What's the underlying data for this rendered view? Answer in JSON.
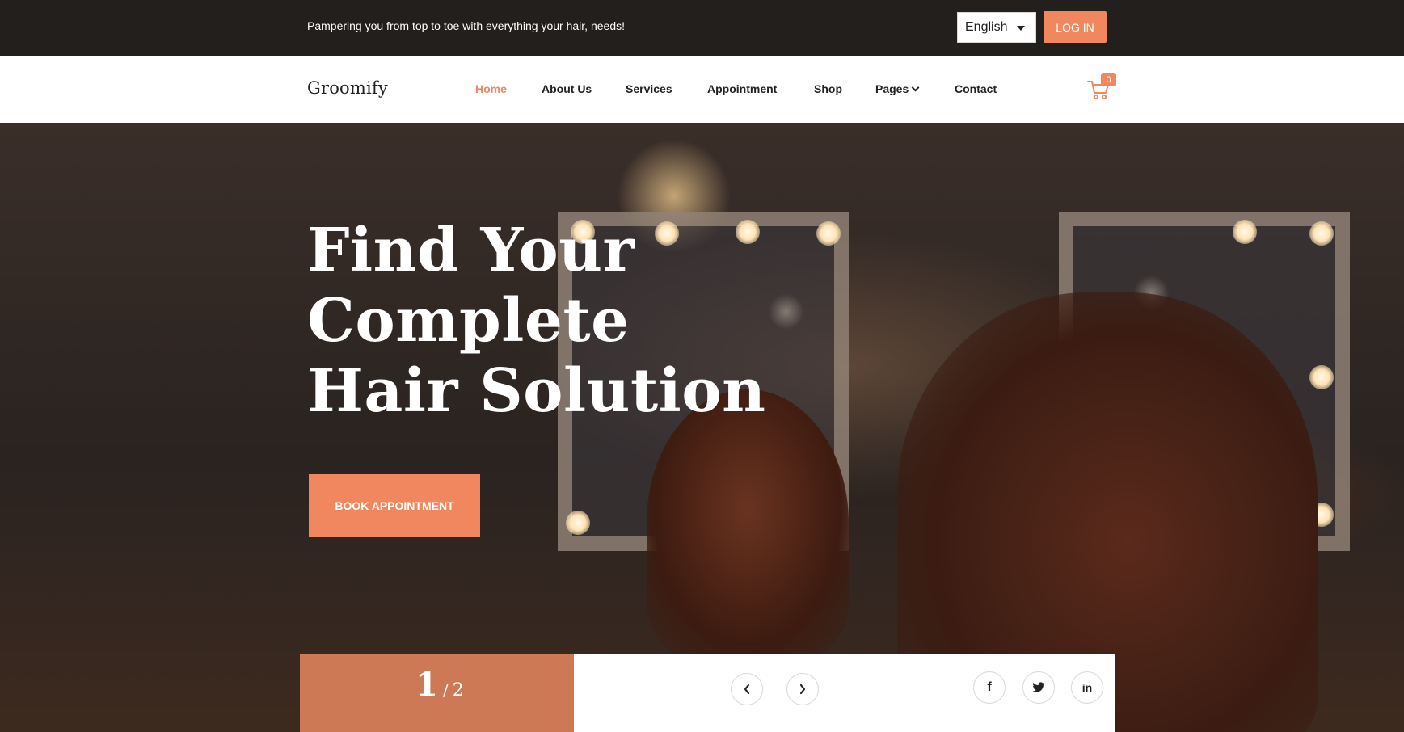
{
  "topbar": {
    "tagline": "Pampering you from top to toe with everything your hair, needs!",
    "language": "English",
    "login_label": "LOG IN"
  },
  "nav": {
    "logo": "Groomify",
    "items": [
      {
        "label": "Home",
        "active": true
      },
      {
        "label": "About Us"
      },
      {
        "label": "Services"
      },
      {
        "label": "Appointment"
      },
      {
        "label": "Shop"
      },
      {
        "label": "Pages",
        "has_dropdown": true
      },
      {
        "label": "Contact"
      }
    ],
    "cart_count": "0"
  },
  "hero": {
    "title_lines": [
      "Find Your",
      "Complete",
      "Hair Solution"
    ],
    "cta_label": "BOOK APPOINTMENT"
  },
  "slider": {
    "current": "1",
    "separator": "/",
    "total": "2",
    "prev_icon": "chevron-left-icon",
    "next_icon": "chevron-right-icon"
  },
  "social": [
    {
      "icon": "facebook-icon",
      "glyph": "f"
    },
    {
      "icon": "twitter-icon"
    },
    {
      "icon": "linkedin-icon",
      "glyph": "in"
    }
  ],
  "colors": {
    "accent": "#f0875e",
    "topbar_bg": "#231f1d"
  }
}
